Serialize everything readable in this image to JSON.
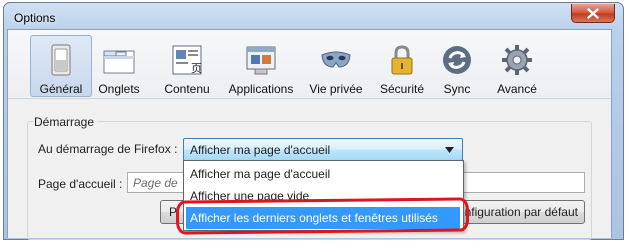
{
  "window": {
    "title": "Options"
  },
  "toolbar": {
    "panes": [
      {
        "label": "Général",
        "icon": "general-switch-icon",
        "selected": true
      },
      {
        "label": "Onglets",
        "icon": "tabs-window-icon",
        "selected": false
      },
      {
        "label": "Contenu",
        "icon": "content-page-icon",
        "selected": false
      },
      {
        "label": "Applications",
        "icon": "applications-icon",
        "selected": false
      },
      {
        "label": "Vie privée",
        "icon": "privacy-mask-icon",
        "selected": false
      },
      {
        "label": "Sécurité",
        "icon": "padlock-icon",
        "selected": false
      },
      {
        "label": "Sync",
        "icon": "sync-arrows-icon",
        "selected": false
      },
      {
        "label": "Avancé",
        "icon": "gear-icon",
        "selected": false
      }
    ]
  },
  "startup": {
    "group_title": "Démarrage",
    "startup_label": "Au démarrage de Firefox :",
    "startup_value": "Afficher ma page d'accueil",
    "homepage_label": "Page d'accueil :",
    "homepage_placeholder": "Page de",
    "restore_default_label": "nfiguration par défaut",
    "left_button_label": "P"
  },
  "dropdown": {
    "options": [
      {
        "label": "Afficher ma page d'accueil",
        "selected": false
      },
      {
        "label": "Afficher une page vide",
        "selected": false
      },
      {
        "label": "Afficher les derniers onglets et fenêtres utilisés",
        "selected": true
      }
    ]
  },
  "colors": {
    "selection": "#3399ff",
    "highlight_ring": "#e0141f"
  }
}
